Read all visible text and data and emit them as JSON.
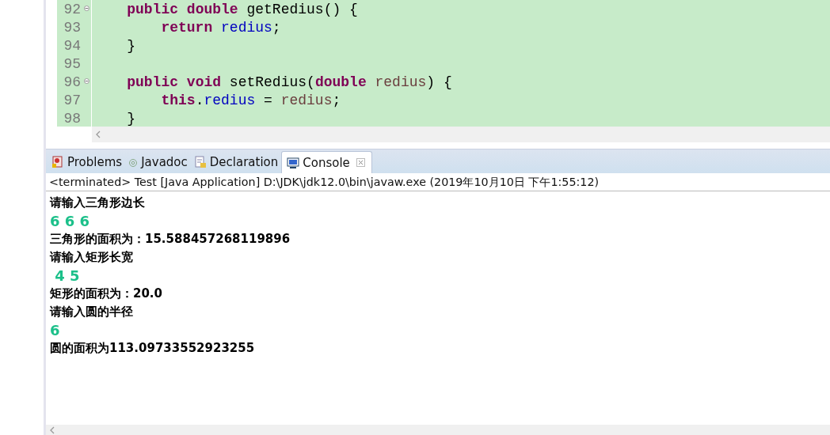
{
  "editor": {
    "lines": [
      {
        "number": "92",
        "fold": true,
        "tokens": [
          {
            "kind": "keyword",
            "text": "    public "
          },
          {
            "kind": "keyword",
            "text": "double "
          },
          {
            "kind": "plain",
            "text": "getRedius() {"
          }
        ]
      },
      {
        "number": "93",
        "fold": false,
        "tokens": [
          {
            "kind": "keyword",
            "text": "        return "
          },
          {
            "kind": "field",
            "text": "redius"
          },
          {
            "kind": "plain",
            "text": ";"
          }
        ]
      },
      {
        "number": "94",
        "fold": false,
        "tokens": [
          {
            "kind": "plain",
            "text": "    }"
          }
        ]
      },
      {
        "number": "95",
        "fold": false
      },
      {
        "number": "96",
        "fold": true,
        "tokens": [
          {
            "kind": "keyword",
            "text": "    public "
          },
          {
            "kind": "keyword",
            "text": "void "
          },
          {
            "kind": "plain",
            "text": "setRedius("
          },
          {
            "kind": "keyword",
            "text": "double "
          },
          {
            "kind": "param",
            "text": "redius"
          },
          {
            "kind": "plain",
            "text": ") {"
          }
        ]
      },
      {
        "number": "97",
        "fold": false,
        "tokens": [
          {
            "kind": "keyword",
            "text": "        this"
          },
          {
            "kind": "plain",
            "text": "."
          },
          {
            "kind": "field",
            "text": "redius"
          },
          {
            "kind": "plain",
            "text": " = "
          },
          {
            "kind": "param",
            "text": "redius"
          },
          {
            "kind": "plain",
            "text": ";"
          }
        ]
      },
      {
        "number": "98",
        "fold": false,
        "tokens": [
          {
            "kind": "plain",
            "text": "    }"
          }
        ]
      }
    ]
  },
  "tabs": [
    {
      "label": "Problems",
      "selected": false,
      "closable": false
    },
    {
      "label": "Javadoc",
      "selected": false,
      "closable": false
    },
    {
      "label": "Declaration",
      "selected": false,
      "closable": false
    },
    {
      "label": "Console",
      "selected": true,
      "closable": true
    }
  ],
  "console": {
    "header": "<terminated> Test [Java Application] D:\\JDK\\jdk12.0\\bin\\javaw.exe (2019年10月10日 下午1:55:12)",
    "lines": [
      {
        "kind": "output",
        "text": "请输入三角形边长"
      },
      {
        "kind": "input",
        "text": "6 6 6"
      },
      {
        "kind": "output",
        "text": "三角形的面积为：15.588457268119896"
      },
      {
        "kind": "output",
        "text": "请输入矩形长宽"
      },
      {
        "kind": "input",
        "text": " 4 5"
      },
      {
        "kind": "output",
        "text": "矩形的面积为：20.0"
      },
      {
        "kind": "output",
        "text": "请输入圆的半径"
      },
      {
        "kind": "input",
        "text": "6"
      },
      {
        "kind": "output",
        "text": "圆的面积为113.09733552923255"
      }
    ]
  }
}
